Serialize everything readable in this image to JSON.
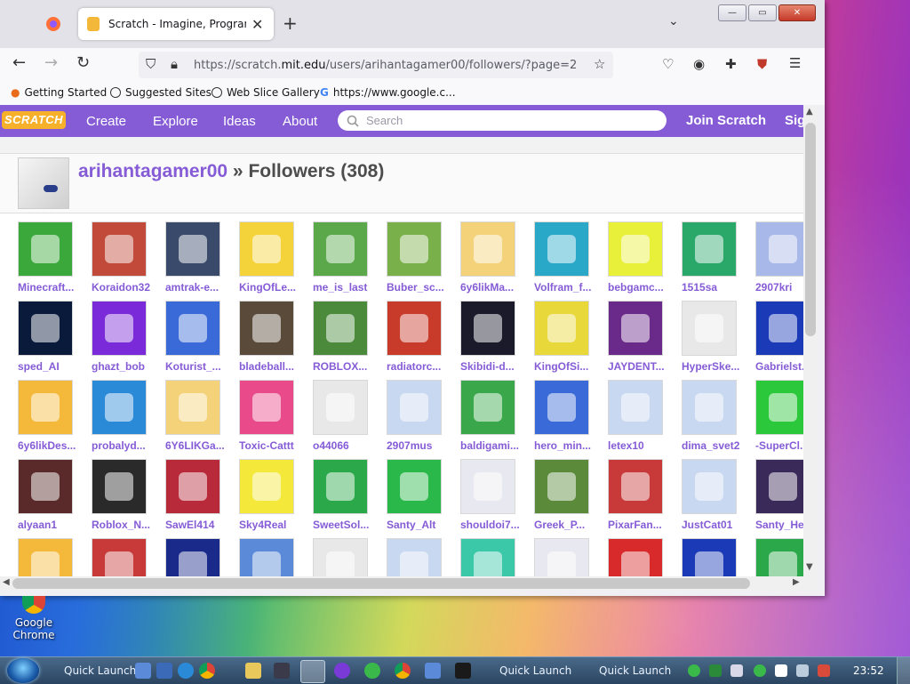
{
  "browser": {
    "tab_title": "Scratch - Imagine, Program, Sh",
    "url_prefix": "https://scratch.",
    "url_domain": "mit.edu",
    "url_path": "/users/arihantagamer00/followers/?page=2",
    "bookmarks": [
      "Getting Started",
      "Suggested Sites",
      "Web Slice Gallery",
      "https://www.google.c..."
    ]
  },
  "scratch_nav": {
    "logo": "SCRATCH",
    "links": [
      "Create",
      "Explore",
      "Ideas",
      "About"
    ],
    "search_placeholder": "Search",
    "join": "Join Scratch",
    "signin": "Sig"
  },
  "profile": {
    "username": "arihantagamer00",
    "title_suffix": " » Followers (308)"
  },
  "followers": [
    {
      "name": "Minecraft...",
      "color": "#3aa83a"
    },
    {
      "name": "Koraidon32",
      "color": "#c24a3a"
    },
    {
      "name": "amtrak-e...",
      "color": "#3a4a6a"
    },
    {
      "name": "KingOfLe...",
      "color": "#f4d23a"
    },
    {
      "name": "me_is_last",
      "color": "#5aa84a"
    },
    {
      "name": "Buber_sc...",
      "color": "#7ab04a"
    },
    {
      "name": "6y6likMa...",
      "color": "#f4d27a"
    },
    {
      "name": "Volfram_f...",
      "color": "#2aa8c8"
    },
    {
      "name": "bebgamc...",
      "color": "#e8f03a"
    },
    {
      "name": "1515sa",
      "color": "#2aa86a"
    },
    {
      "name": "2907kri",
      "color": "#a8b8e8"
    },
    {
      "name": "sped_AI",
      "color": "#0a1a3a"
    },
    {
      "name": "ghazt_bob",
      "color": "#7a2ad8"
    },
    {
      "name": "Koturist_...",
      "color": "#3a6ad8"
    },
    {
      "name": "bladeball...",
      "color": "#5a4a3a"
    },
    {
      "name": "ROBLOX...",
      "color": "#4a8a3a"
    },
    {
      "name": "radiatorc...",
      "color": "#c83a2a"
    },
    {
      "name": "Skibidi-d...",
      "color": "#1a1a2a"
    },
    {
      "name": "KingOfSi...",
      "color": "#e8d83a"
    },
    {
      "name": "JAYDENT...",
      "color": "#6a2a8a"
    },
    {
      "name": "HyperSke...",
      "color": "#e8e8e8"
    },
    {
      "name": "Gabrielst...",
      "color": "#1a3ab8"
    },
    {
      "name": "6y6likDes...",
      "color": "#f4b83a"
    },
    {
      "name": "probalyd...",
      "color": "#2a8ad8"
    },
    {
      "name": "6Y6LIKGa...",
      "color": "#f4d27a"
    },
    {
      "name": "Toxic-Cattt",
      "color": "#e84a8a"
    },
    {
      "name": "o44066",
      "color": "#e8e8e8"
    },
    {
      "name": "2907mus",
      "color": "#c8d8f0"
    },
    {
      "name": "baldigami...",
      "color": "#3aa84a"
    },
    {
      "name": "hero_min...",
      "color": "#3a6ad8"
    },
    {
      "name": "letex10",
      "color": "#c8d8f0"
    },
    {
      "name": "dima_svet2",
      "color": "#c8d8f0"
    },
    {
      "name": "-SuperCl...",
      "color": "#2ac83a"
    },
    {
      "name": "alyaan1",
      "color": "#5a2a2a"
    },
    {
      "name": "Roblox_N...",
      "color": "#2a2a2a"
    },
    {
      "name": "SawEl414",
      "color": "#b82a3a"
    },
    {
      "name": "Sky4Real",
      "color": "#f4e83a"
    },
    {
      "name": "SweetSol...",
      "color": "#2aa84a"
    },
    {
      "name": "Santy_Alt",
      "color": "#2ab84a"
    },
    {
      "name": "shouldoi7...",
      "color": "#e8e8f0"
    },
    {
      "name": "Greek_P...",
      "color": "#5a8a3a"
    },
    {
      "name": "PixarFan...",
      "color": "#c83a3a"
    },
    {
      "name": "JustCat01",
      "color": "#c8d8f0"
    },
    {
      "name": "Santy_He",
      "color": "#3a2a5a"
    },
    {
      "name": "",
      "color": "#f4b83a"
    },
    {
      "name": "",
      "color": "#c83a3a"
    },
    {
      "name": "",
      "color": "#1a2a8a"
    },
    {
      "name": "",
      "color": "#5a8ad8"
    },
    {
      "name": "",
      "color": "#e8e8e8"
    },
    {
      "name": "",
      "color": "#c8d8f0"
    },
    {
      "name": "",
      "color": "#3ac8a8"
    },
    {
      "name": "",
      "color": "#e8e8f0"
    },
    {
      "name": "",
      "color": "#d82a2a"
    },
    {
      "name": "",
      "color": "#1a3ab8"
    },
    {
      "name": "",
      "color": "#2aa84a"
    }
  ],
  "desktop": {
    "icon_label": "Google Chrome"
  },
  "taskbar": {
    "quick_launch_1": "Quick Launch",
    "quick_launch_2": "Quick Launch",
    "quick_launch_3": "Quick Launch",
    "clock": "23:52"
  }
}
